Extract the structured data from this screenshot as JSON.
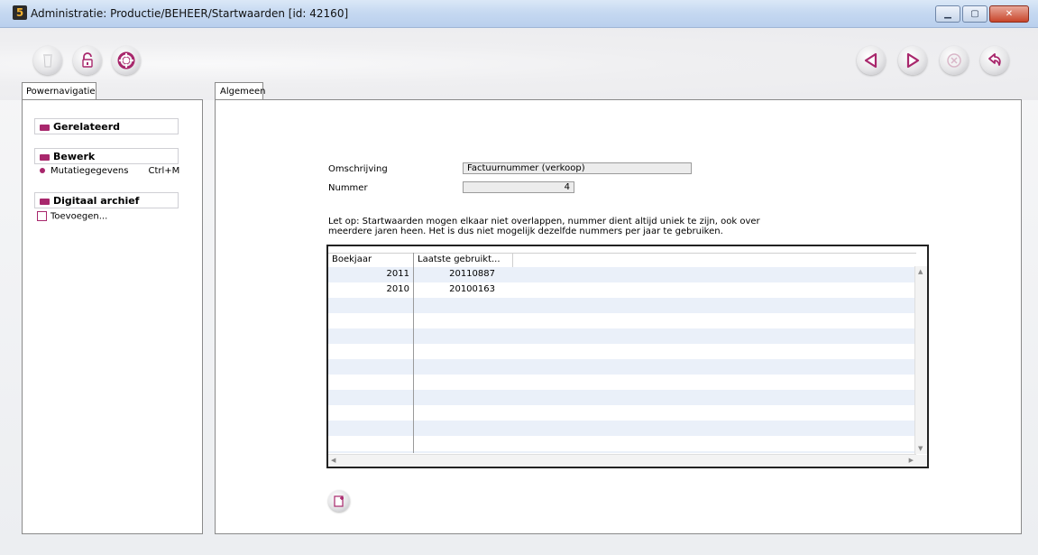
{
  "window": {
    "title": "Administratie: Productie/BEHEER/Startwaarden [id: 42160]"
  },
  "toolbar": {
    "left_icons": [
      "trash-icon",
      "unlock-icon",
      "lifebuoy-icon"
    ],
    "right_icons": [
      "previous-icon",
      "next-icon",
      "cancel-icon",
      "undo-icon"
    ]
  },
  "left_tab": {
    "label": "Powernavigatie"
  },
  "nav": {
    "related": {
      "title": "Gerelateerd"
    },
    "edit": {
      "title": "Bewerk",
      "items": [
        {
          "label": "Mutatiegegevens",
          "shortcut": "Ctrl+M"
        }
      ]
    },
    "archive": {
      "title": "Digitaal archief",
      "items": [
        {
          "label": "Toevoegen..."
        }
      ]
    }
  },
  "main_tab": {
    "label": "Algemeen"
  },
  "form": {
    "description_label": "Omschrijving",
    "description_value": "Factuurnummer (verkoop)",
    "number_label": "Nummer",
    "number_value": "4"
  },
  "note": "Let op: Startwaarden mogen elkaar niet overlappen, nummer dient altijd uniek te zijn, ook over meerdere jaren heen. Het is dus niet mogelijk dezelfde nummers per jaar te gebruiken.",
  "table": {
    "columns": [
      "Boekjaar",
      "Laatste gebruikt..."
    ],
    "rows": [
      [
        "2011",
        "20110887"
      ],
      [
        "2010",
        "20100163"
      ]
    ]
  },
  "colors": {
    "accent": "#a8276c",
    "row_alt": "#eaf0f9"
  }
}
